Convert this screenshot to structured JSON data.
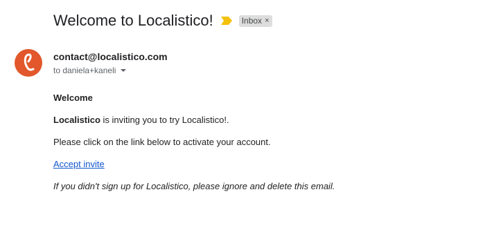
{
  "email": {
    "subject": "Welcome to Localistico!",
    "importance_icon": "importance-marker-icon",
    "label": {
      "text": "Inbox",
      "remove": "×"
    },
    "sender": {
      "avatar_letter": "l",
      "avatar_color": "#e2572b",
      "address": "contact@localistico.com",
      "to_line": "to daniela+kaneli"
    },
    "body": {
      "greeting": "Welcome",
      "invite_brand": "Localistico",
      "invite_rest": " is inviting you to try Localistico!.",
      "activate": "Please click on the link below to activate your account.",
      "link_text": "Accept invite",
      "note": "If you didn't sign up for Localistico, please ignore and delete this email."
    }
  },
  "colors": {
    "importance": "#f4c20d",
    "link": "#1155cc",
    "chip_bg": "#dddddd"
  }
}
